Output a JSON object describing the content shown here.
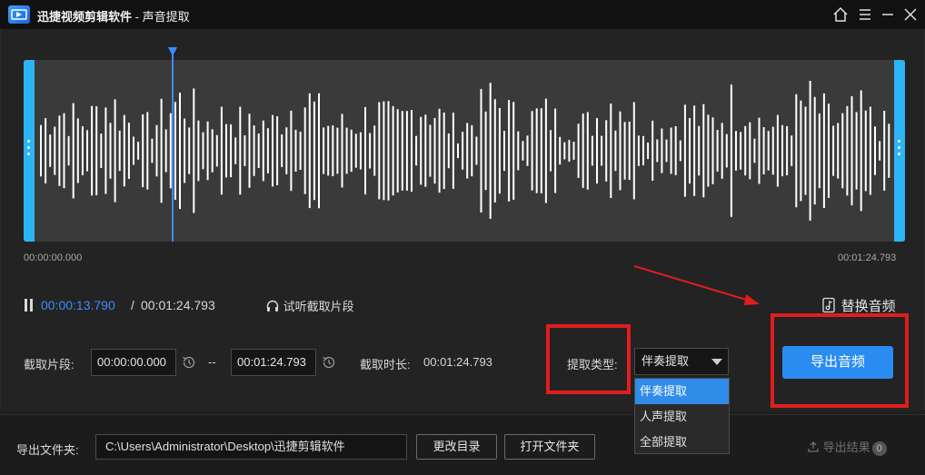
{
  "window": {
    "app_name": "迅捷视频剪辑软件",
    "section": " - 声音提取"
  },
  "waveform": {
    "start_time": "00:00:00.000",
    "end_time": "00:01:24.793",
    "color": "#ffffff",
    "handle_color": "#2db4f5",
    "playhead_color": "#3c8cff"
  },
  "playback": {
    "current_time": "00:00:13.790",
    "separator": "/",
    "total_time": "00:01:24.793",
    "listen_label": "试听截取片段",
    "replace_label": "替换音频"
  },
  "clip": {
    "label": "截取片段:",
    "start_value": "00:00:00.000",
    "dash": "--",
    "end_value": "00:01:24.793",
    "duration_label": "截取时长:",
    "duration_value": "00:01:24.793"
  },
  "extract": {
    "type_label": "提取类型:",
    "selected": "伴奏提取",
    "options": [
      "伴奏提取",
      "人声提取",
      "全部提取"
    ]
  },
  "export_button": "导出音频",
  "bottom": {
    "folder_label": "导出文件夹:",
    "folder_path": "C:\\Users\\Administrator\\Desktop\\迅捷剪辑软件",
    "change_dir": "更改目录",
    "open_folder": "打开文件夹",
    "result_label": "导出结果",
    "result_count": "0"
  },
  "colors": {
    "accent": "#2a8cf0",
    "annotation": "#e11d1d"
  }
}
